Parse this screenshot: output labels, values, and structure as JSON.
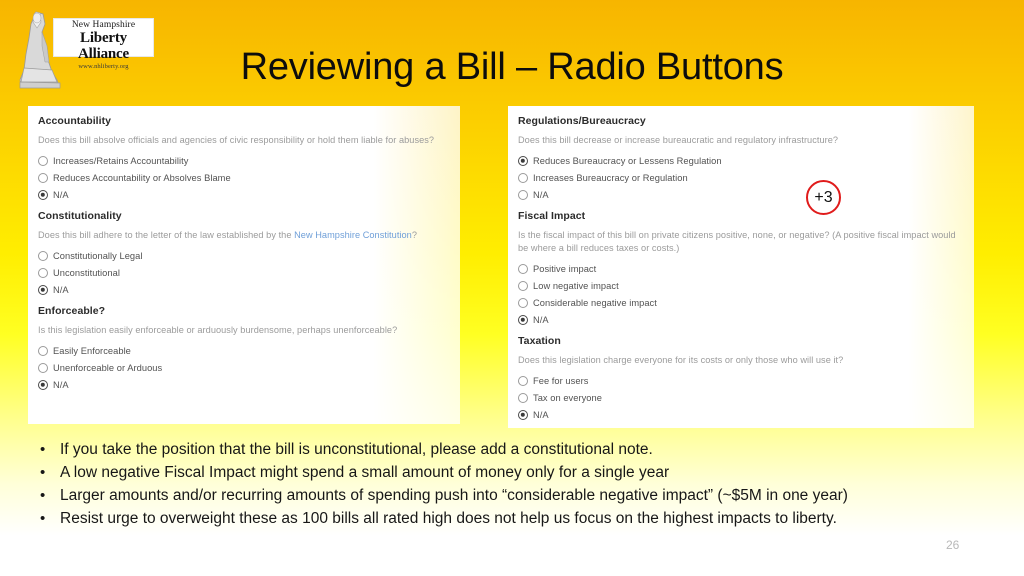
{
  "slide": {
    "title": "Reviewing a Bill – Radio Buttons",
    "page_number": "26",
    "background_top_color": "#f7b500",
    "background_bottom_color": "#ffffff"
  },
  "logo": {
    "name": "nh-liberty-alliance-logo",
    "line1": "New Hampshire",
    "line2": "Liberty Alliance",
    "line3": "www.nhliberty.org"
  },
  "annotation": {
    "label": "+3",
    "color": "#e01b1b"
  },
  "form": {
    "left_panel": [
      {
        "title": "Accountability",
        "description": "Does this bill absolve officials and agencies of civic responsibility or hold them liable for abuses?",
        "link_text": "",
        "description_suffix": "",
        "options": [
          {
            "label": "Increases/Retains Accountability",
            "selected": false
          },
          {
            "label": "Reduces Accountability or Absolves Blame",
            "selected": false
          },
          {
            "label": "N/A",
            "selected": true
          }
        ]
      },
      {
        "title": "Constitutionality",
        "description": "Does this bill adhere to the letter of the law established by the ",
        "link_text": "New Hampshire Constitution",
        "description_suffix": "?",
        "options": [
          {
            "label": "Constitutionally Legal",
            "selected": false
          },
          {
            "label": "Unconstitutional",
            "selected": false
          },
          {
            "label": "N/A",
            "selected": true
          }
        ]
      },
      {
        "title": "Enforceable?",
        "description": "Is this legislation easily enforceable or arduously burdensome, perhaps unenforceable?",
        "link_text": "",
        "description_suffix": "",
        "options": [
          {
            "label": "Easily Enforceable",
            "selected": false
          },
          {
            "label": "Unenforceable or Arduous",
            "selected": false
          },
          {
            "label": "N/A",
            "selected": true
          }
        ]
      }
    ],
    "right_panel": [
      {
        "title": "Regulations/Bureaucracy",
        "description": "Does this bill decrease or increase bureaucratic and regulatory infrastructure?",
        "link_text": "",
        "description_suffix": "",
        "options": [
          {
            "label": "Reduces Bureaucracy or Lessens Regulation",
            "selected": true
          },
          {
            "label": "Increases Bureaucracy or Regulation",
            "selected": false
          },
          {
            "label": "N/A",
            "selected": false
          }
        ]
      },
      {
        "title": "Fiscal Impact",
        "description": "Is the fiscal impact of this bill on private citizens positive, none, or negative? (A positive fiscal impact would be where a bill reduces taxes or costs.)",
        "link_text": "",
        "description_suffix": "",
        "options": [
          {
            "label": "Positive impact",
            "selected": false
          },
          {
            "label": "Low negative impact",
            "selected": false
          },
          {
            "label": "Considerable negative impact",
            "selected": false
          },
          {
            "label": "N/A",
            "selected": true
          }
        ]
      },
      {
        "title": "Taxation",
        "description": "Does this legislation charge everyone for its costs or only those who will use it?",
        "link_text": "",
        "description_suffix": "",
        "options": [
          {
            "label": "Fee for users",
            "selected": false
          },
          {
            "label": "Tax on everyone",
            "selected": false
          },
          {
            "label": "N/A",
            "selected": true
          }
        ]
      }
    ]
  },
  "bullets": {
    "marker": "•",
    "items": [
      "If you take the position that the bill is unconstitutional, please add a constitutional note.",
      "A low negative Fiscal Impact might spend a small amount of money only for a single year",
      "Larger amounts and/or recurring amounts of spending push into “considerable negative impact” (~$5M in one year)",
      "Resist urge to overweight these as 100 bills all rated high does not help us focus on the highest impacts to liberty."
    ]
  }
}
